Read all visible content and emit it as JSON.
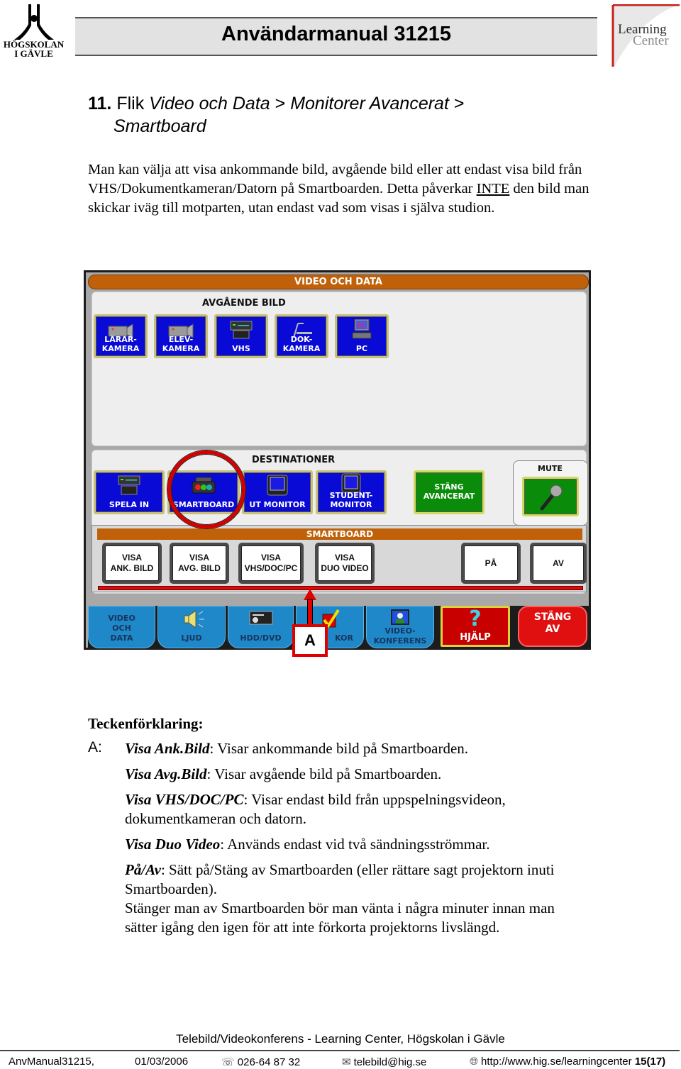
{
  "header": {
    "logo_left_line1": "HÖGSKOLAN",
    "logo_left_line2": "I GÄVLE",
    "title": "Användarmanual 31215",
    "logo_right_line1": "Learning",
    "logo_right_line2": "Center",
    "accent_color": "#c81e1e"
  },
  "section": {
    "number": "11.",
    "prefix": "Flik",
    "path_part1": "Video och Data",
    "separator": ">",
    "path_part2": "Monitorer Avancerat",
    "path_part3": "Smartboard",
    "intro_part1": "Man kan välja att visa ankommande bild, avgående bild eller att endast visa bild från VHS/Dokumentkameran/Datorn på Smartboarden. Detta påverkar ",
    "intro_underlined": "INTE",
    "intro_part2": " den bild man skickar iväg till motparten, utan endast vad som visas i själva studion."
  },
  "screenshot": {
    "top_title": "VIDEO OCH DATA",
    "avgaende": {
      "label": "AVGÅENDE BILD",
      "buttons": [
        {
          "label": "LÄRAR-\nKAMERA",
          "icon": "camera-icon"
        },
        {
          "label": "ELEV-\nKAMERA",
          "icon": "camera-icon"
        },
        {
          "label": "VHS",
          "icon": "vcr-icon"
        },
        {
          "label": "DOK-\nKAMERA",
          "icon": "document-camera-icon"
        },
        {
          "label": "PC",
          "icon": "pc-icon"
        }
      ]
    },
    "destinationer": {
      "label": "DESTINATIONER",
      "buttons": [
        {
          "label": "SPELA IN",
          "icon": "vcr-icon"
        },
        {
          "label": "SMARTBOARD",
          "icon": "smartboard-icon"
        },
        {
          "label": "UT MONITOR",
          "icon": "monitor-icon"
        },
        {
          "label": "STUDENT-\nMONITOR",
          "icon": "monitor-icon"
        }
      ],
      "close_advanced": "STÄNG\nAVANCERAT",
      "mute_label": "MUTE"
    },
    "smartboard": {
      "title": "SMARTBOARD",
      "buttons": [
        {
          "label": "VISA\nANK. BILD"
        },
        {
          "label": "VISA\nAVG. BILD"
        },
        {
          "label": "VISA\nVHS/DOC/PC"
        },
        {
          "label": "VISA\nDUO VIDEO"
        },
        {
          "label": "PÅ"
        },
        {
          "label": "AV"
        }
      ]
    },
    "tabs": [
      {
        "label": "VIDEO\nOCH\nDATA"
      },
      {
        "label": "LJUD"
      },
      {
        "label": "HDD/DVD"
      },
      {
        "label": "KOR"
      },
      {
        "label": "VIDEO-\nKONFERENS"
      },
      {
        "label": "HJÄLP"
      },
      {
        "label": "STÄNG\nAV"
      }
    ],
    "annotation_label": "A"
  },
  "legend": {
    "title": "Teckenförklaring:",
    "key": "A",
    "key_suffix": ":",
    "items": [
      {
        "term": "Visa Ank.Bild",
        "text": ": Visar ankommande bild på Smartboarden."
      },
      {
        "term": "Visa Avg.Bild",
        "text": ": Visar avgående bild på Smartboarden."
      },
      {
        "term": "Visa VHS/DOC/PC",
        "text": ": Visar endast bild från uppspelningsvideon, dokumentkameran och datorn."
      },
      {
        "term": "Visa Duo Video",
        "text": ": Används endast vid två sändningsströmmar."
      },
      {
        "term": "På/Av",
        "text": ": Sätt på/Stäng av Smartboarden (eller rättare sagt projektorn inuti Smartboarden)."
      }
    ],
    "note": "Stänger man av Smartboarden bör man vänta i några minuter innan man sätter igång den igen för att inte förkorta projektorns livslängd."
  },
  "footer": {
    "center": "Telebild/Videokonferens - Learning Center, Högskolan i Gävle",
    "doc_id": "AnvManual31215,",
    "date": "01/03/2006",
    "phone": "026-64 87 32",
    "email": "telebild@hig.se",
    "url": "http://www.hig.se/learningcenter",
    "page": "15(17)"
  }
}
